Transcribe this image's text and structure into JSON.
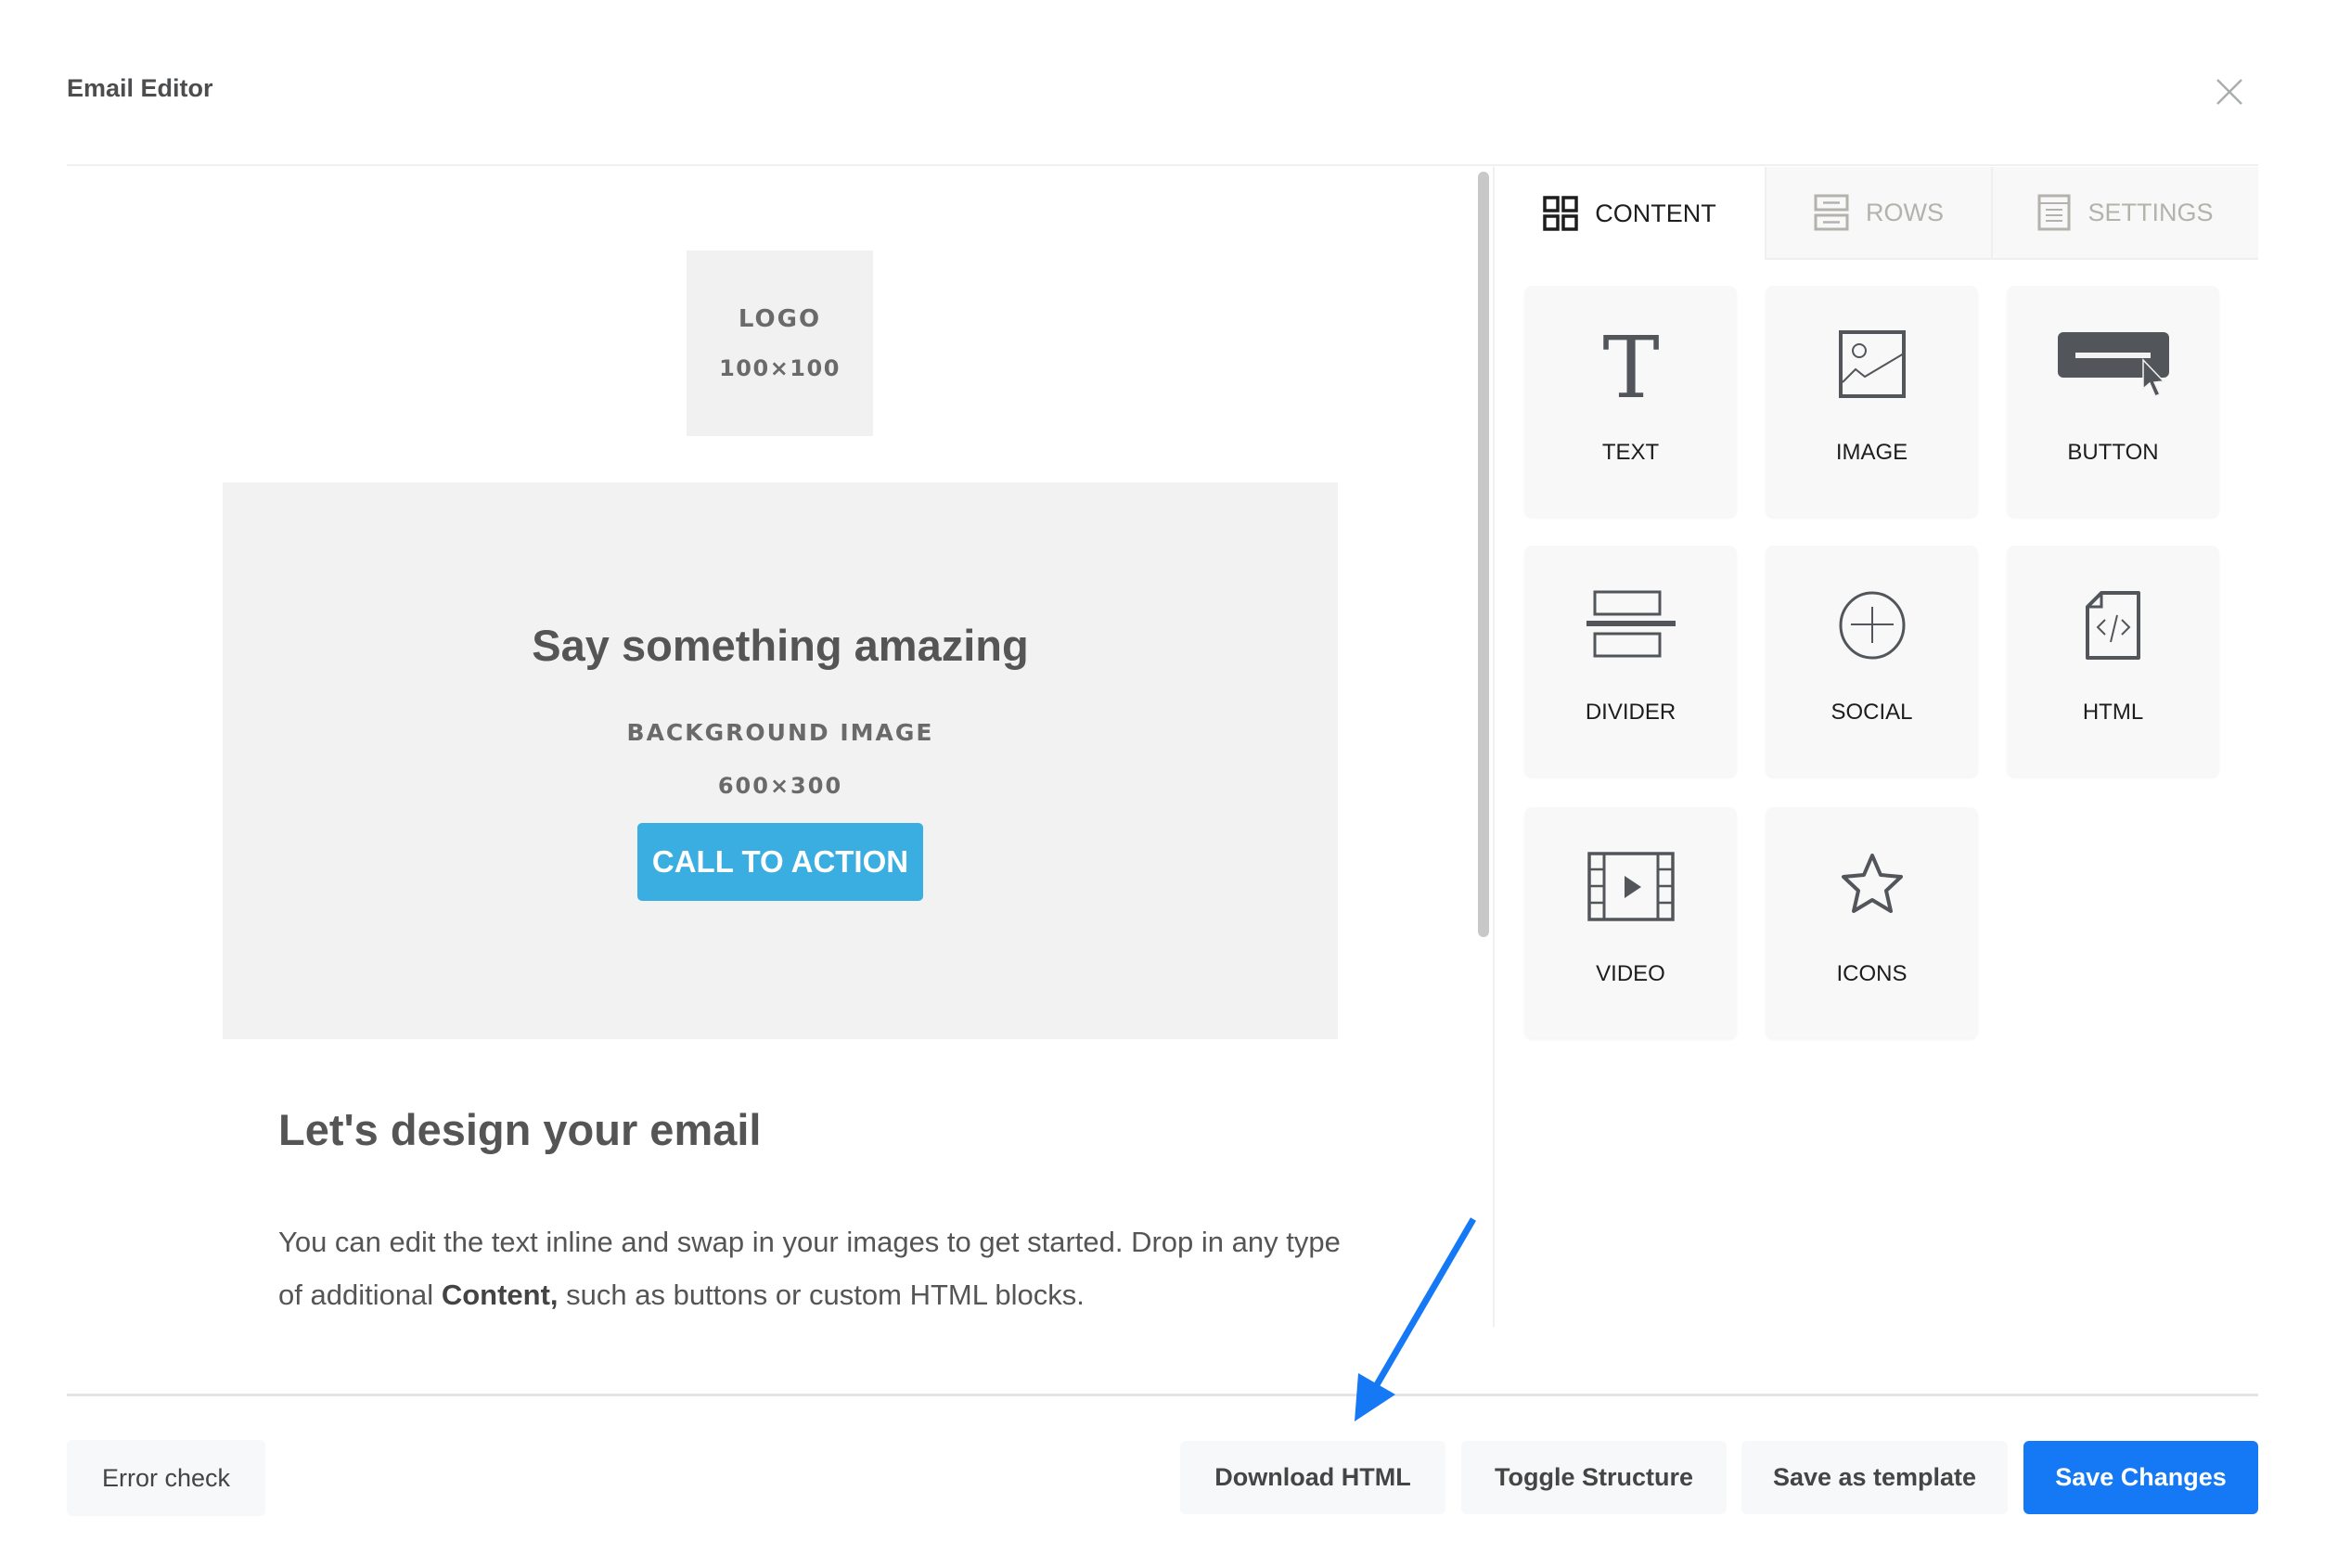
{
  "header": {
    "title": "Email Editor",
    "close_icon": "close-icon"
  },
  "canvas": {
    "logo_placeholder": {
      "label": "LOGO",
      "size": "100×100"
    },
    "hero": {
      "title": "Say something amazing",
      "bg_label": "BACKGROUND IMAGE",
      "bg_size": "600×300",
      "cta_label": "CALL TO ACTION",
      "cta_color": "#3aaee0"
    },
    "section_title": "Let's design your email",
    "body_text_before": "You can edit the text inline and swap in your images to get started. Drop in any type of additional ",
    "body_text_bold": "Content,",
    "body_text_after": " such as buttons or custom HTML blocks."
  },
  "panel": {
    "tabs": [
      {
        "label": "CONTENT",
        "icon": "grid-icon",
        "active": true
      },
      {
        "label": "ROWS",
        "icon": "rows-icon",
        "active": false
      },
      {
        "label": "SETTINGS",
        "icon": "settings-doc-icon",
        "active": false
      }
    ],
    "blocks": [
      {
        "label": "TEXT",
        "icon": "text-icon"
      },
      {
        "label": "IMAGE",
        "icon": "image-icon"
      },
      {
        "label": "BUTTON",
        "icon": "button-icon"
      },
      {
        "label": "DIVIDER",
        "icon": "divider-icon"
      },
      {
        "label": "SOCIAL",
        "icon": "social-icon"
      },
      {
        "label": "HTML",
        "icon": "html-icon"
      },
      {
        "label": "VIDEO",
        "icon": "video-icon"
      },
      {
        "label": "ICONS",
        "icon": "star-icon"
      }
    ]
  },
  "footer": {
    "error_check": "Error check",
    "download_html": "Download HTML",
    "toggle_structure": "Toggle Structure",
    "save_as_template": "Save as template",
    "save_changes": "Save Changes",
    "primary_color": "#1579f6"
  },
  "annotation": {
    "arrow_color": "#1579f6",
    "points_to": "Download HTML"
  }
}
